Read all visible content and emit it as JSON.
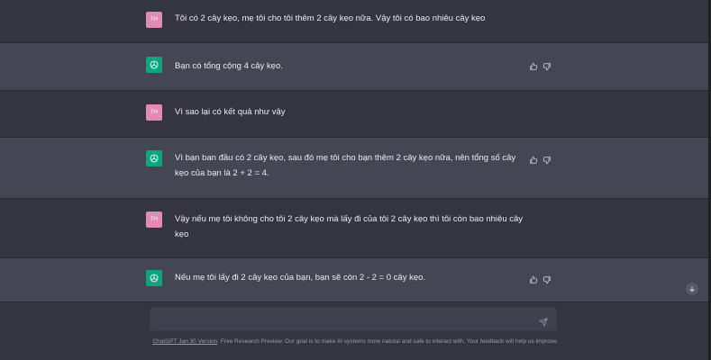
{
  "conversation": [
    {
      "role": "user",
      "avatar": "TH",
      "text": "Tôi có 2 cây kẹo, mẹ tôi cho tôi thêm 2 cây kẹo nữa. Vậy tôi có bao nhiêu cây kẹo"
    },
    {
      "role": "assistant",
      "text": "Bạn có tổng cộng 4 cây kẹo."
    },
    {
      "role": "user",
      "avatar": "TH",
      "text": "Vì sao lại có kết quả như vậy"
    },
    {
      "role": "assistant",
      "text": "Vì bạn ban đầu có 2 cây kẹo, sau đó mẹ tôi cho bạn thêm 2 cây kẹo nữa, nên tổng số cây kẹo của bạn là 2 + 2 = 4."
    },
    {
      "role": "user",
      "avatar": "TH",
      "text": "Vậy nếu mẹ tôi không cho tôi 2 cây kẹo mà lấy đi của tôi 2 cây kẹo thì tôi còn bao nhiêu cây kẹo"
    },
    {
      "role": "assistant",
      "text": "Nếu mẹ tôi lấy đi 2 cây kẹo của bạn, bạn sẽ còn 2 - 2 = 0 cây kẹo."
    }
  ],
  "input": {
    "value": "",
    "placeholder": ""
  },
  "footer": {
    "link": "ChatGPT Jan 30 Version",
    "text": ". Free Research Preview. Our goal is to make AI systems more natural and safe to interact with. Your feedback will help us improve."
  },
  "colors": {
    "background": "#343541",
    "bot_row": "#444654",
    "user_avatar": "#e08bb6",
    "bot_avatar": "#10a37f"
  }
}
